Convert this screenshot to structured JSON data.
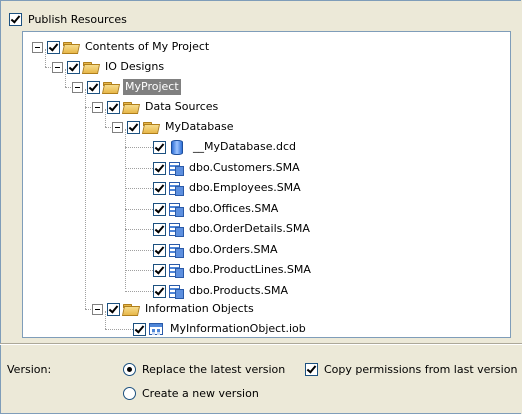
{
  "publish": {
    "label": "Publish Resources",
    "checked": true
  },
  "tree": {
    "root": "Contents of My Project",
    "io_designs": "IO Designs",
    "myproject": "MyProject",
    "data_sources": "Data Sources",
    "mydatabase": "MyDatabase",
    "files": [
      "__MyDatabase.dcd",
      "dbo.Customers.SMA",
      "dbo.Employees.SMA",
      "dbo.Offices.SMA",
      "dbo.OrderDetails.SMA",
      "dbo.Orders.SMA",
      "dbo.ProductLines.SMA",
      "dbo.Products.SMA"
    ],
    "information_objects": "Information Objects",
    "info_object_file": "MyInformationObject.iob"
  },
  "version": {
    "label": "Version:",
    "replace_label": "Replace the latest version",
    "copy_permissions_label": "Copy permissions from last version",
    "new_version_label": "Create a new version",
    "selected": "replace",
    "copy_permissions_checked": true
  },
  "colors": {
    "selection_bg": "#808080",
    "dialog_bg": "#ece9d8",
    "border": "#7f9db9"
  }
}
